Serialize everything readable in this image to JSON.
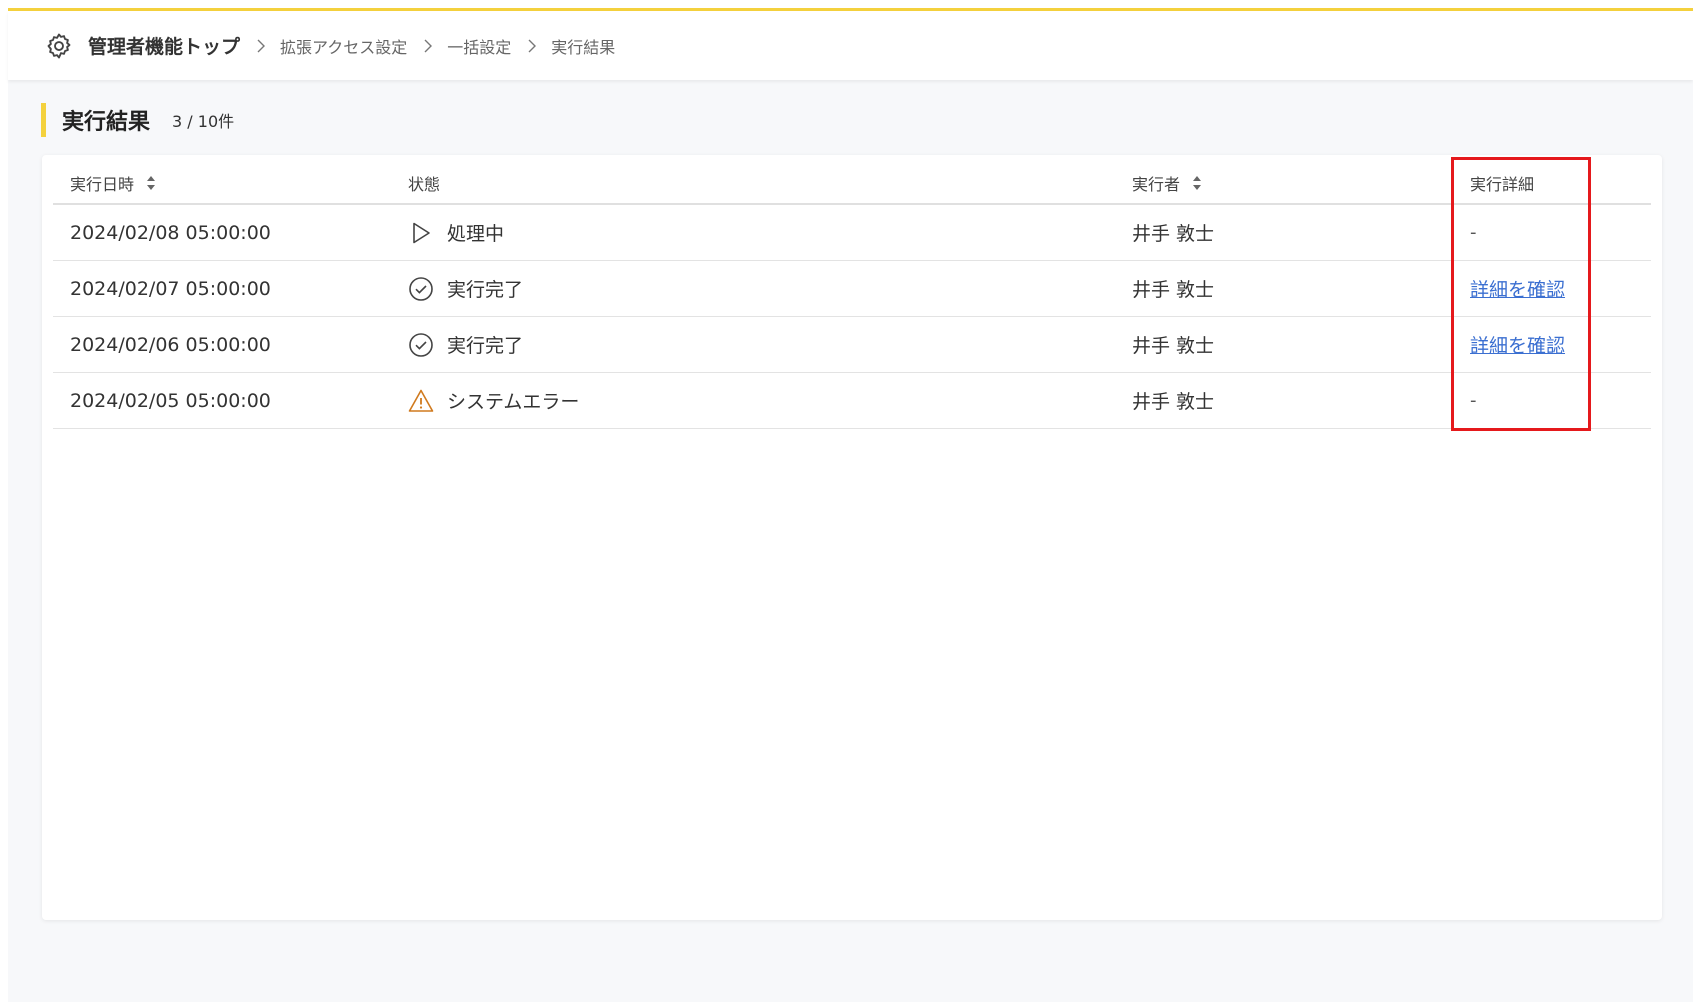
{
  "header": {
    "root_label": "管理者機能トップ",
    "breadcrumbs": [
      "拡張アクセス設定",
      "一括設定",
      "実行結果"
    ]
  },
  "page": {
    "title": "実行結果",
    "count": "3 / 10件"
  },
  "table": {
    "columns": [
      "実行日時",
      "状態",
      "実行者",
      "実行詳細"
    ],
    "rows": [
      {
        "datetime": "2024/02/08 05:00:00",
        "status_icon": "play-icon",
        "status": "処理中",
        "executor": "井手 敦士",
        "detail": "-"
      },
      {
        "datetime": "2024/02/07 05:00:00",
        "status_icon": "check-circle-icon",
        "status": "実行完了",
        "executor": "井手 敦士",
        "detail": "詳細を確認"
      },
      {
        "datetime": "2024/02/06 05:00:00",
        "status_icon": "check-circle-icon",
        "status": "実行完了",
        "executor": "井手 敦士",
        "detail": "詳細を確認"
      },
      {
        "datetime": "2024/02/05 05:00:00",
        "status_icon": "warning-icon",
        "status": "システムエラー",
        "executor": "井手 敦士",
        "detail": "-"
      }
    ]
  },
  "colors": {
    "accent": "#f4d13d",
    "link": "#3b6fd1",
    "warning": "#d07a1e",
    "highlight": "#e5191c"
  }
}
